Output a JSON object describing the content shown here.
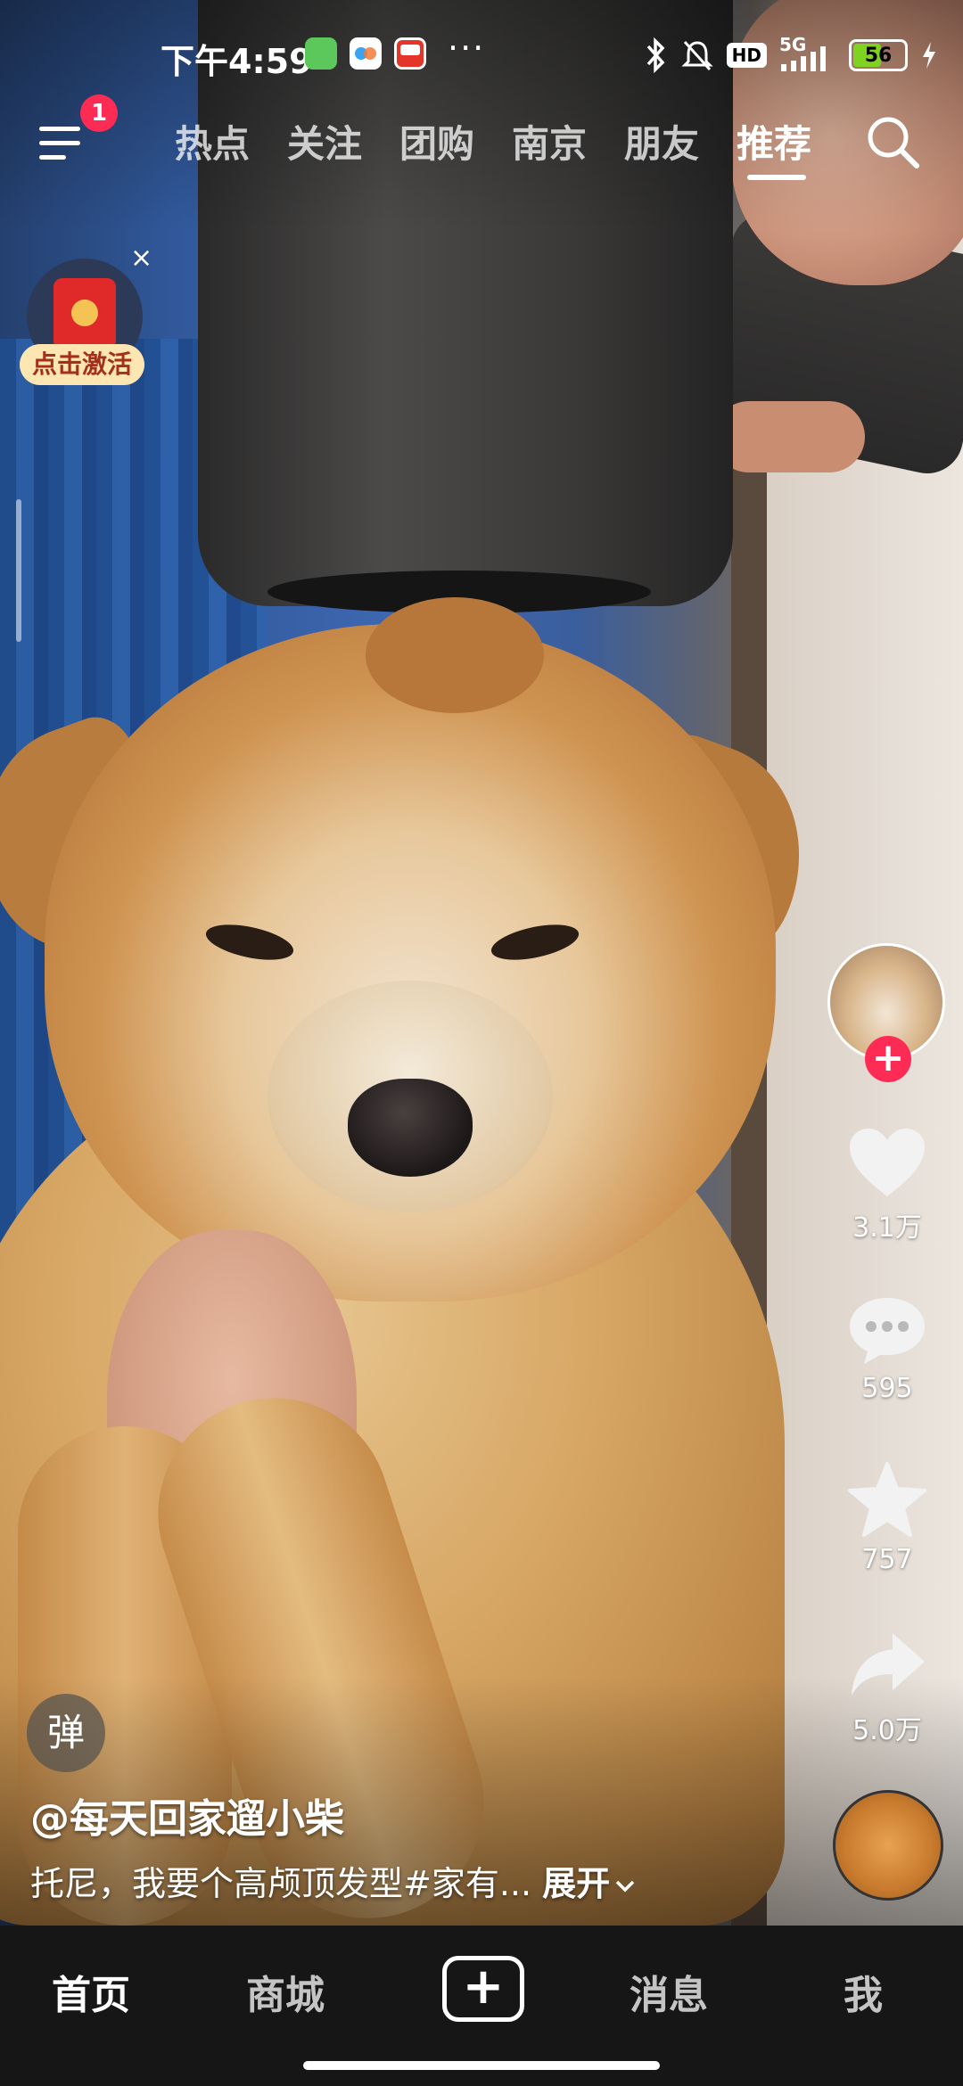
{
  "status_bar": {
    "time": "下午4:59",
    "network": "5G",
    "hd_label": "HD",
    "battery": "56",
    "battery_level": 0.56,
    "app_icons": [
      "wechat-icon",
      "cloud-icon",
      "app-58-icon"
    ]
  },
  "top_nav": {
    "notification_count": "1",
    "tabs": [
      {
        "label": "热点"
      },
      {
        "label": "关注"
      },
      {
        "label": "团购"
      },
      {
        "label": "南京"
      },
      {
        "label": "朋友"
      },
      {
        "label": "推荐"
      }
    ],
    "active_tab": "推荐"
  },
  "red_packet": {
    "label": "点击激活",
    "close": "×"
  },
  "video": {
    "author": "@每天回家遛小柴",
    "description": "托尼，我要个高颅顶发型#家有...",
    "expand_label": "展开",
    "danmu_label": "弹"
  },
  "actions": {
    "likes": "3.1万",
    "comments": "595",
    "favorites": "757",
    "shares": "5.0万"
  },
  "bottom_nav": {
    "items": [
      {
        "label": "首页"
      },
      {
        "label": "商城"
      },
      {
        "label": "+"
      },
      {
        "label": "消息"
      },
      {
        "label": "我"
      }
    ],
    "active": "首页"
  },
  "colors": {
    "accent": "#fe2c55",
    "bottom_bar": "#161616",
    "battery_fill": "#7ed321",
    "red_packet_label_bg": "#fde6b2"
  }
}
